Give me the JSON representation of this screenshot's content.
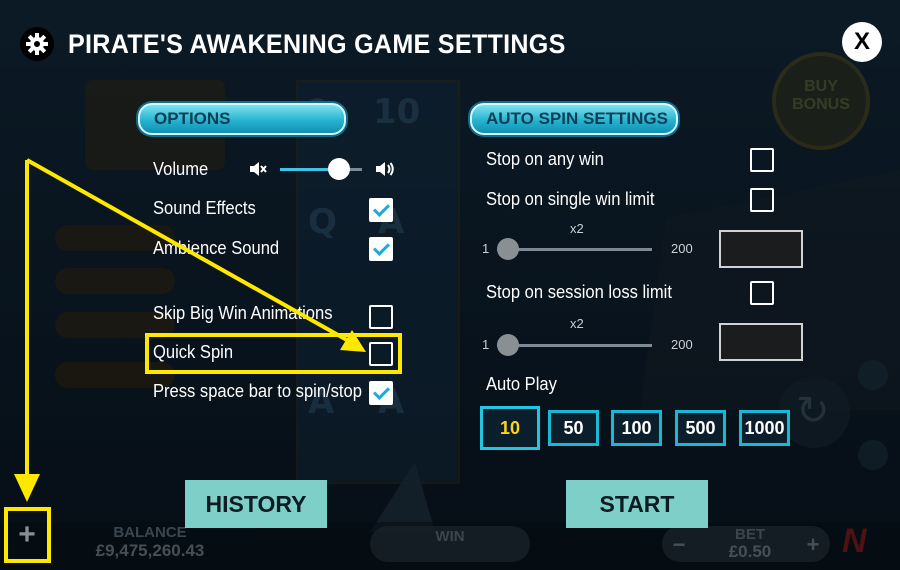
{
  "background": {
    "buy_bonus_label": "BUY BONUS",
    "balance_label": "BALANCE",
    "balance_value": "£9,475,260.43",
    "win_label": "WIN",
    "bet_label": "BET",
    "bet_value": "£0.50",
    "bet_minus": "−",
    "bet_plus": "+"
  },
  "header": {
    "title": "PIRATE'S AWAKENING GAME SETTINGS",
    "close_label": "X"
  },
  "options": {
    "section_label": "OPTIONS",
    "volume_label": "Volume",
    "volume_level": 0.72,
    "items": [
      {
        "label": "Sound Effects",
        "checked": true
      },
      {
        "label": "Ambience Sound",
        "checked": true
      },
      {
        "label": "Skip Big Win Animations",
        "checked": false
      },
      {
        "label": "Quick Spin",
        "checked": false
      },
      {
        "label": "Press space bar to spin/stop",
        "checked": true
      }
    ]
  },
  "auto_spin": {
    "section_label": "AUTO SPIN SETTINGS",
    "stop_on_any_win": {
      "label": "Stop on any win",
      "checked": false
    },
    "stop_on_single_win": {
      "label": "Stop on single win limit",
      "checked": false
    },
    "single_win_slider": {
      "min": "1",
      "max": "200",
      "multiplier": "x2",
      "value": 1
    },
    "stop_on_loss": {
      "label": "Stop on session loss limit",
      "checked": false
    },
    "loss_slider": {
      "min": "1",
      "max": "200",
      "multiplier": "x2",
      "value": 1
    },
    "auto_play_label": "Auto Play",
    "auto_play_options": [
      "10",
      "50",
      "100",
      "500",
      "1000"
    ],
    "auto_play_selected": "10"
  },
  "buttons": {
    "history": "HISTORY",
    "start": "START"
  },
  "annotation": {
    "plus_label": "+",
    "highlight_color": "#ffe800"
  }
}
